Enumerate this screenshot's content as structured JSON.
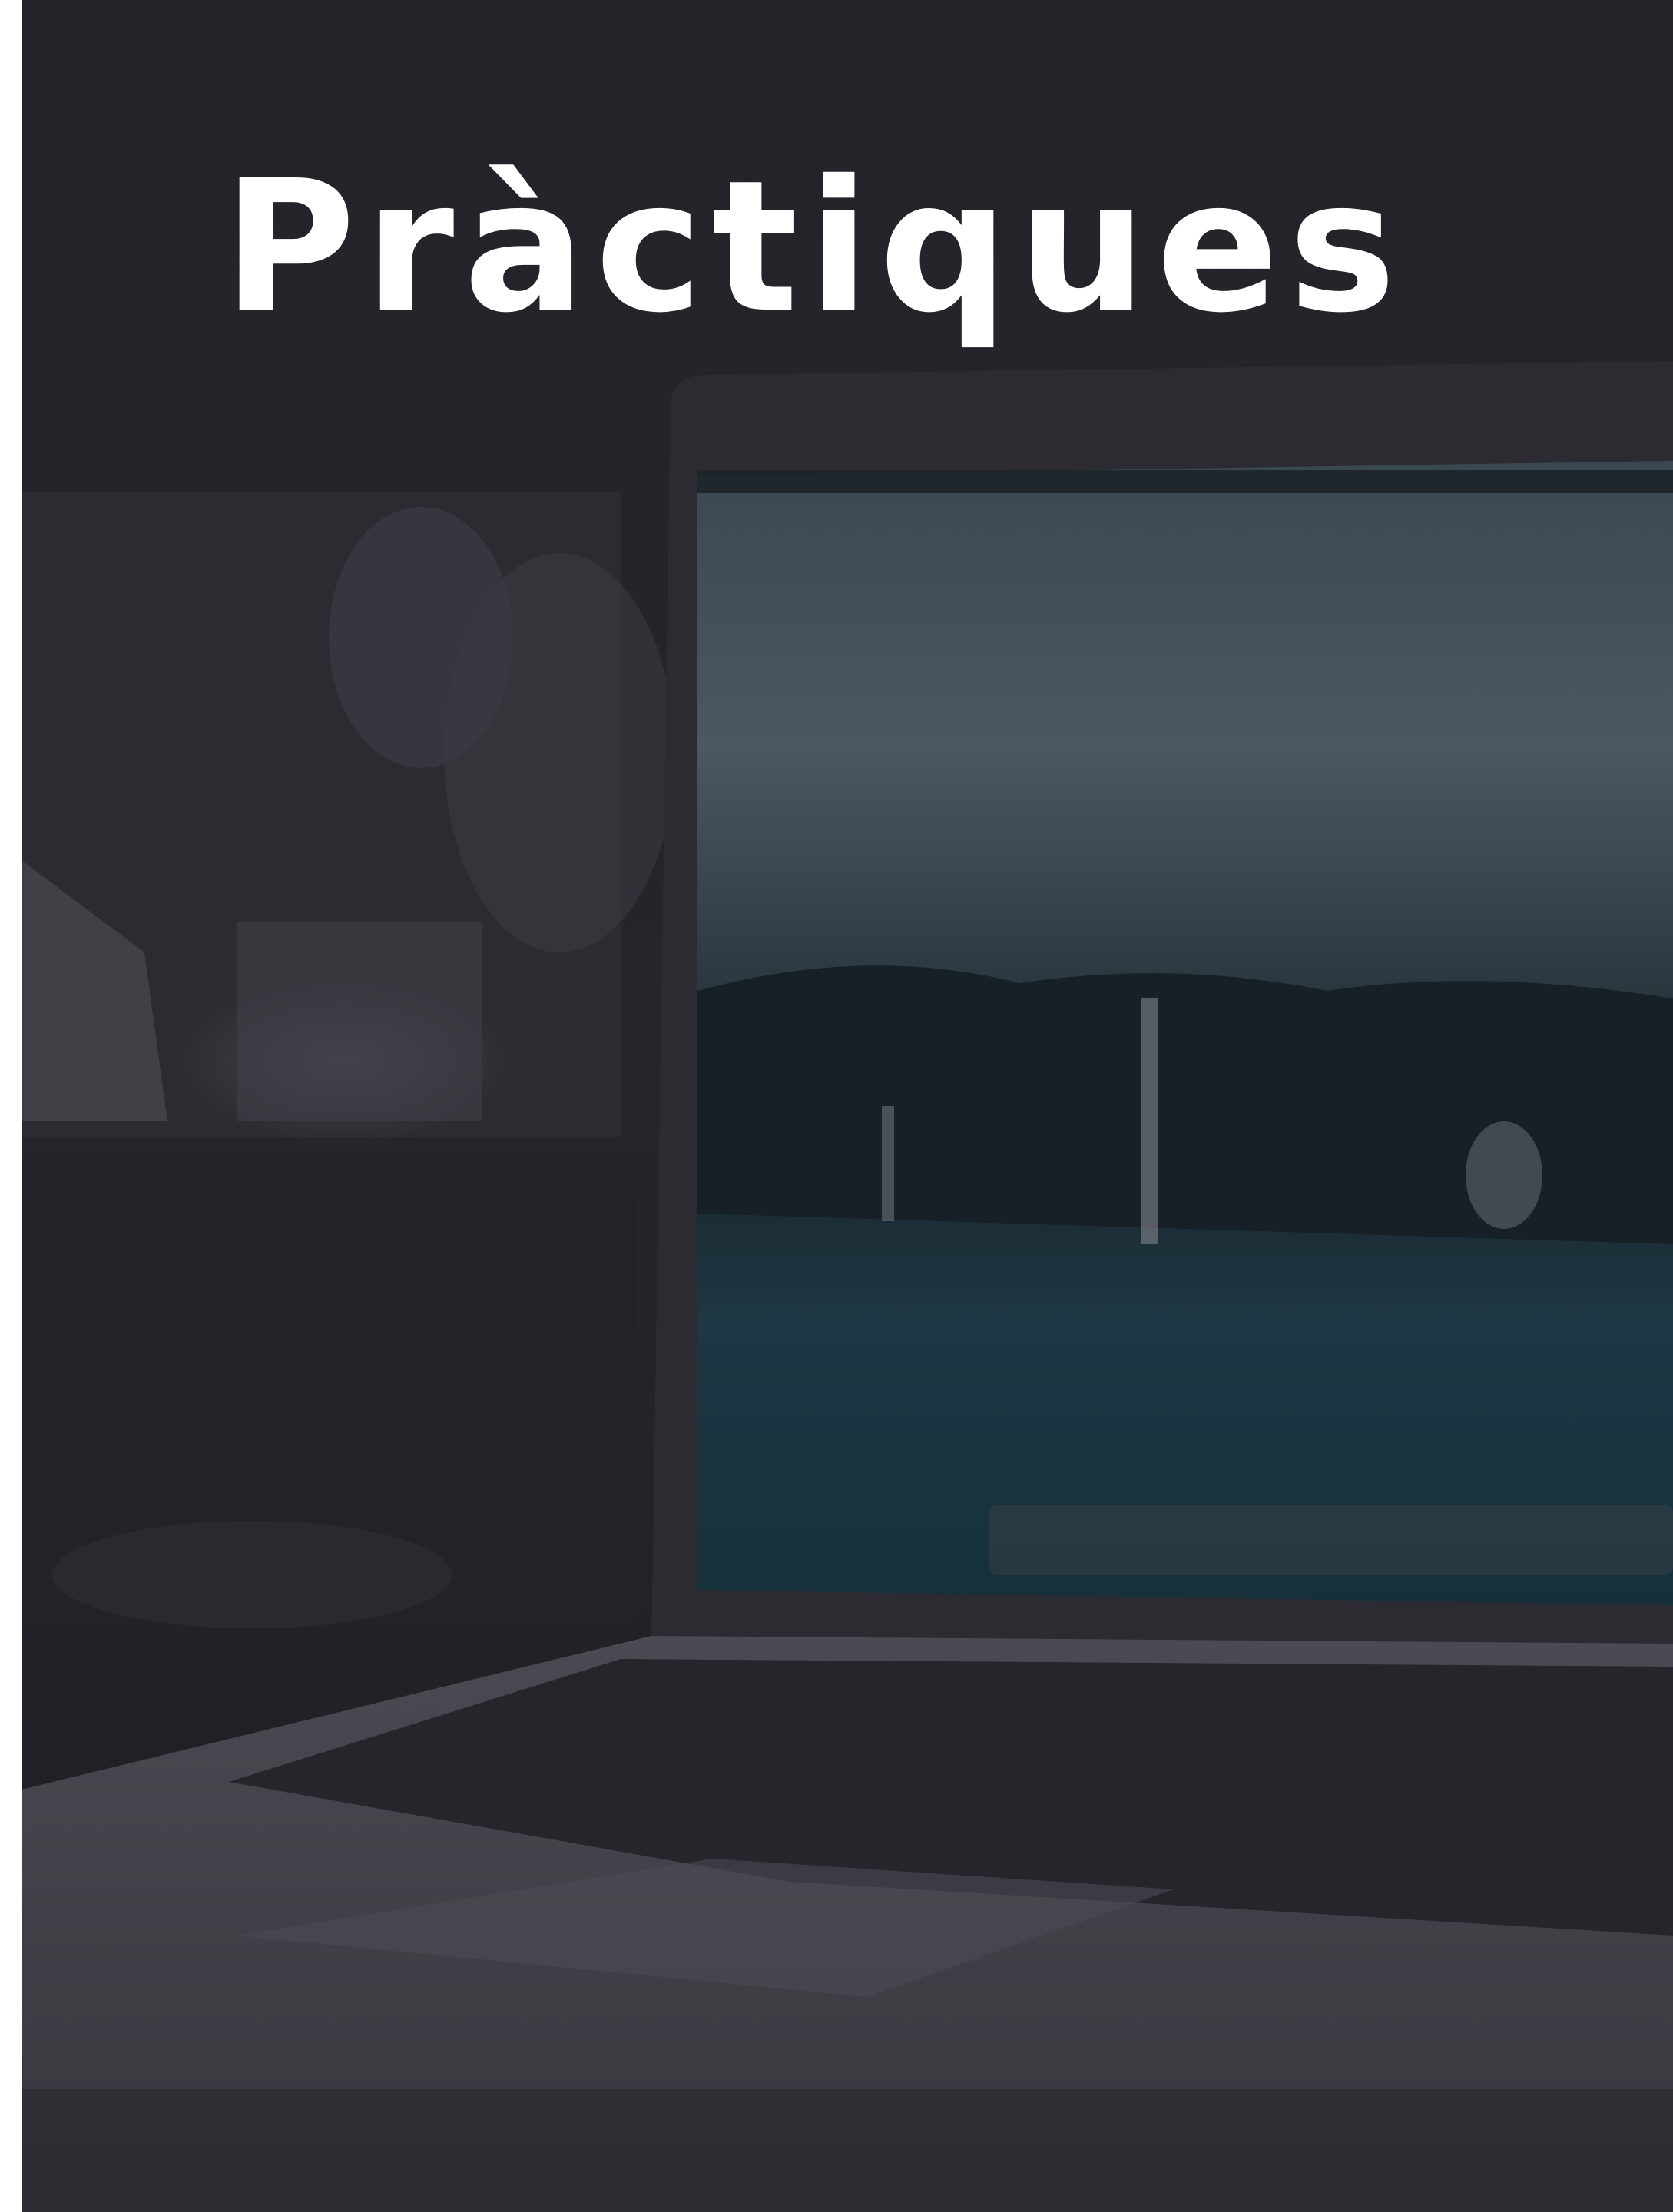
{
  "cover": {
    "title": "Pràctiques",
    "overlay_color": "#202026",
    "title_color": "#ffffff",
    "background_photo": "laptop-on-desk-with-ocean-wallpaper"
  }
}
